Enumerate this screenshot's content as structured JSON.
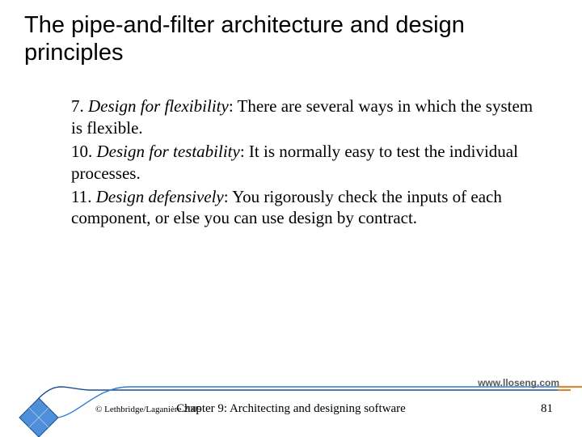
{
  "title": "The pipe-and-filter architecture and design principles",
  "items": [
    {
      "num": "7.",
      "principle": "Design for flexibility",
      "text": ": There are several ways in which the system is flexible."
    },
    {
      "num": "10.",
      "principle": "Design for testability",
      "text": ": It is normally easy to test the individual processes."
    },
    {
      "num": "11.",
      "principle": "Design defensively",
      "text": ": You rigorously check the inputs of each component, or else you can use design by contract."
    }
  ],
  "footer": {
    "url": "www.lloseng.com",
    "copyright": "© Lethbridge/Laganière 2005",
    "chapter": "Chapter 9: Architecting and designing software",
    "page": "81"
  },
  "colors": {
    "accent": "#2e7bd1",
    "accent_dark": "#1a4e8e"
  }
}
